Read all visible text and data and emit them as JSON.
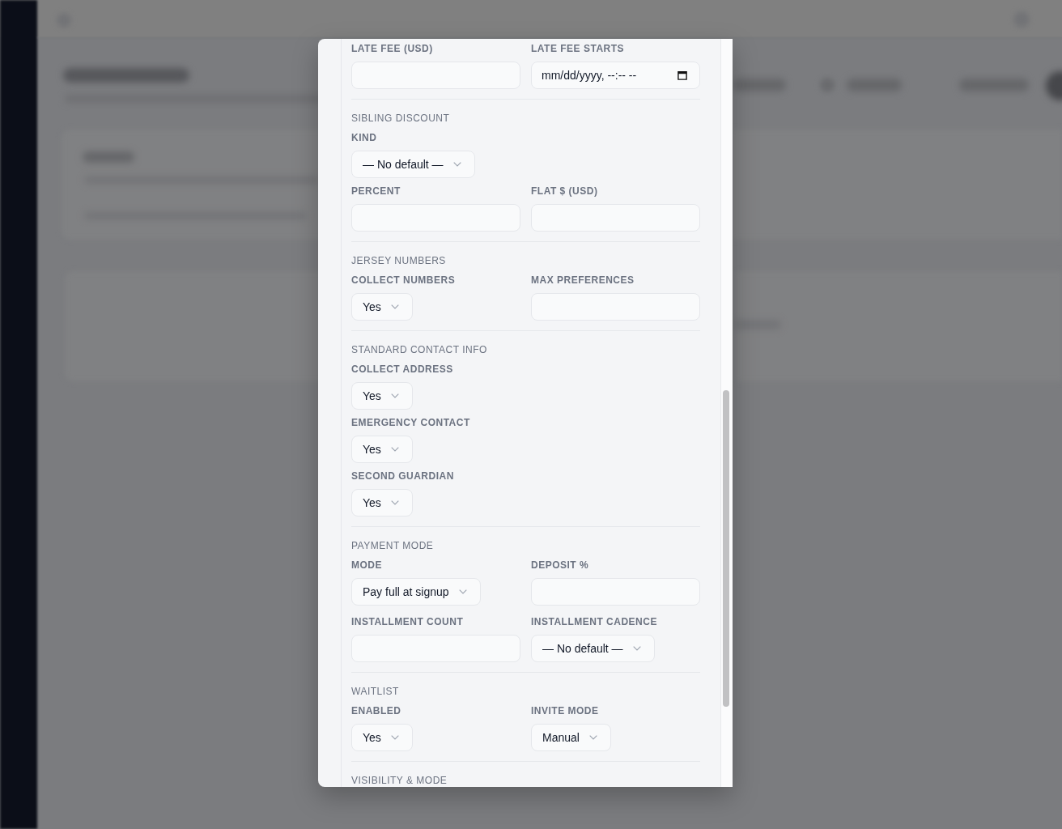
{
  "dialog": {
    "sections": [
      {
        "rows": [
          [
            {
              "label": "LATE FEE (USD)",
              "kind": "text"
            },
            {
              "label": "LATE FEE STARTS",
              "kind": "datetime",
              "placeholder": "mm/dd/yyyy, --:-- --"
            }
          ]
        ]
      },
      {
        "title": "SIBLING DISCOUNT",
        "rows": [
          [
            {
              "label": "KIND",
              "kind": "select",
              "value": "— No default —"
            }
          ],
          [
            {
              "label": "PERCENT",
              "kind": "text"
            },
            {
              "label": "FLAT $ (USD)",
              "kind": "text"
            }
          ]
        ]
      },
      {
        "title": "JERSEY NUMBERS",
        "rows": [
          [
            {
              "label": "COLLECT NUMBERS",
              "kind": "select",
              "value": "Yes"
            },
            {
              "label": "MAX PREFERENCES",
              "kind": "text"
            }
          ]
        ]
      },
      {
        "title": "STANDARD CONTACT INFO",
        "rows": [
          [
            {
              "label": "COLLECT ADDRESS",
              "kind": "select",
              "value": "Yes"
            }
          ],
          [
            {
              "label": "EMERGENCY CONTACT",
              "kind": "select",
              "value": "Yes"
            }
          ],
          [
            {
              "label": "SECOND GUARDIAN",
              "kind": "select",
              "value": "Yes"
            }
          ]
        ]
      },
      {
        "title": "PAYMENT MODE",
        "rows": [
          [
            {
              "label": "MODE",
              "kind": "select",
              "value": "Pay full at signup"
            },
            {
              "label": "DEPOSIT %",
              "kind": "text"
            }
          ],
          [
            {
              "label": "INSTALLMENT COUNT",
              "kind": "text"
            },
            {
              "label": "INSTALLMENT CADENCE",
              "kind": "select",
              "value": "— No default —"
            }
          ]
        ]
      },
      {
        "title": "WAITLIST",
        "rows": [
          [
            {
              "label": "ENABLED",
              "kind": "select",
              "value": "Yes"
            },
            {
              "label": "INVITE MODE",
              "kind": "select",
              "value": "Manual"
            }
          ]
        ]
      },
      {
        "title": "VISIBILITY & MODE"
      }
    ]
  }
}
